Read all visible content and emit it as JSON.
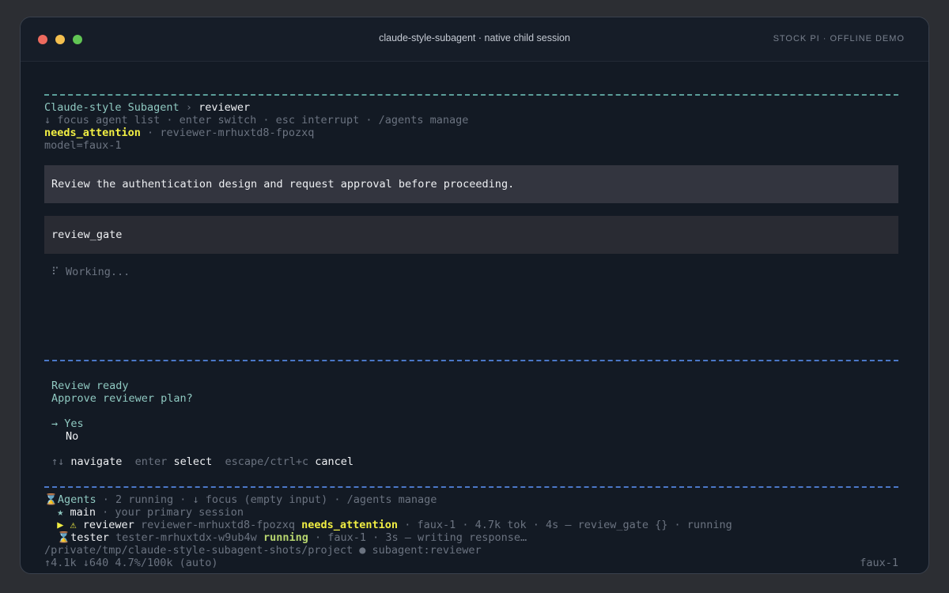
{
  "window": {
    "title": "claude-style-subagent · native child session",
    "badge": "STOCK PI · OFFLINE DEMO"
  },
  "header": {
    "crumb_root": "Claude-style Subagent",
    "crumb_sep": " › ",
    "crumb_current": "reviewer",
    "hints": "↓ focus agent list · enter switch · esc interrupt · /agents manage",
    "status": "needs_attention",
    "status_sep": " · ",
    "session_id": "reviewer-mrhuxtd8-fpozxq",
    "model": "model=faux-1"
  },
  "conversation": {
    "user_prompt": "Review the authentication design and request approval before proceeding.",
    "tool_call": "review_gate",
    "working_spinner": "⠏",
    "working_text": " Working..."
  },
  "dialog": {
    "title": "Review ready",
    "question": "Approve reviewer plan?",
    "selected_marker": "→ ",
    "options": [
      "Yes",
      "No"
    ],
    "hint_nav_key": "↑↓",
    "hint_nav": " navigate  ",
    "hint_enter_key": "enter",
    "hint_enter": " select  ",
    "hint_cancel_key": "escape/ctrl+c",
    "hint_cancel": " cancel"
  },
  "agents": {
    "icon": "⌛",
    "label": "Agents",
    "summary": " · 2 running · ↓ focus (empty input) · /agents manage",
    "rows": [
      {
        "marker": "  ★ ",
        "name": "main",
        "rest": " · your primary session"
      },
      {
        "marker": "  ▶ ⚠ ",
        "name": "reviewer",
        "id": " reviewer-mrhuxtd8-fpozxq ",
        "status": "needs_attention",
        "rest": " · faux-1 · 4.7k tok · 4s — review_gate {} · running"
      },
      {
        "marker": "  ⌛",
        "name": "tester",
        "id": " tester-mrhuxtdx-w9ub4w ",
        "status": "running",
        "rest": " · faux-1 · 3s — writing response…"
      }
    ]
  },
  "footer": {
    "path": "/private/tmp/claude-style-subagent-shots/project ● subagent:reviewer",
    "usage": "↑4.1k ↓640 4.7%/100k (auto)",
    "model": "faux-1"
  },
  "colors": {
    "background": "#131a24",
    "accent_teal": "#8fc9c1",
    "attention_yellow": "#f1ee43",
    "running_green": "#b7d66f",
    "rule_teal": "#5b9e9a",
    "rule_blue": "#4b78c8"
  }
}
